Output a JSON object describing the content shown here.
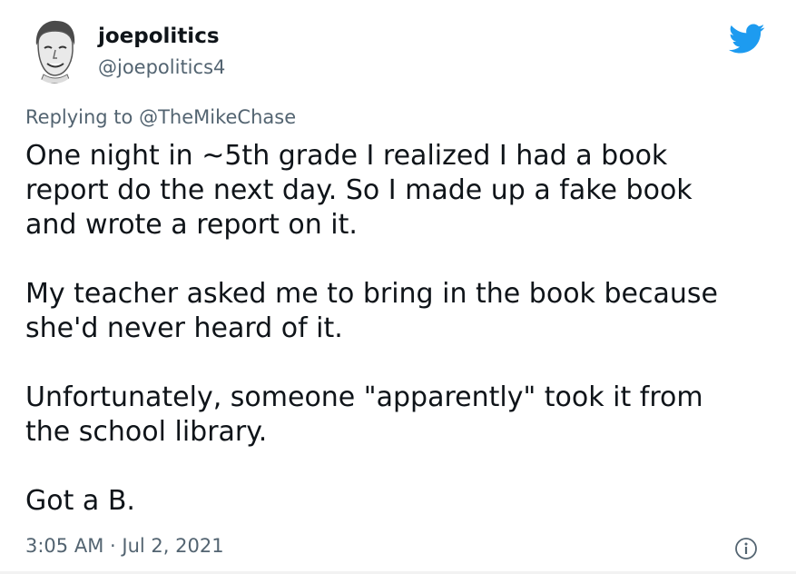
{
  "user": {
    "display_name": "joepolitics",
    "handle": "@joepolitics4",
    "avatar_icon": "profile-photo"
  },
  "brand": {
    "icon": "twitter-bird-icon",
    "color": "#1d9bf0"
  },
  "reply": {
    "prefix": "Replying to",
    "mention": "@TheMikeChase"
  },
  "body": {
    "p1": [
      "One night in ~5th grade I realized I had a book",
      "report do the next day. So I made up a fake book",
      "and wrote a report on it."
    ],
    "p2": [
      "My teacher asked me to bring in the book because",
      "she'd never heard of it."
    ],
    "p3": [
      "Unfortunately, someone \"apparently\" took it from",
      "the school library."
    ],
    "p4": [
      "Got a B."
    ]
  },
  "meta": {
    "time": "3:05 AM",
    "separator": "·",
    "date": "Jul 2, 2021"
  },
  "info_icon": "info-icon"
}
